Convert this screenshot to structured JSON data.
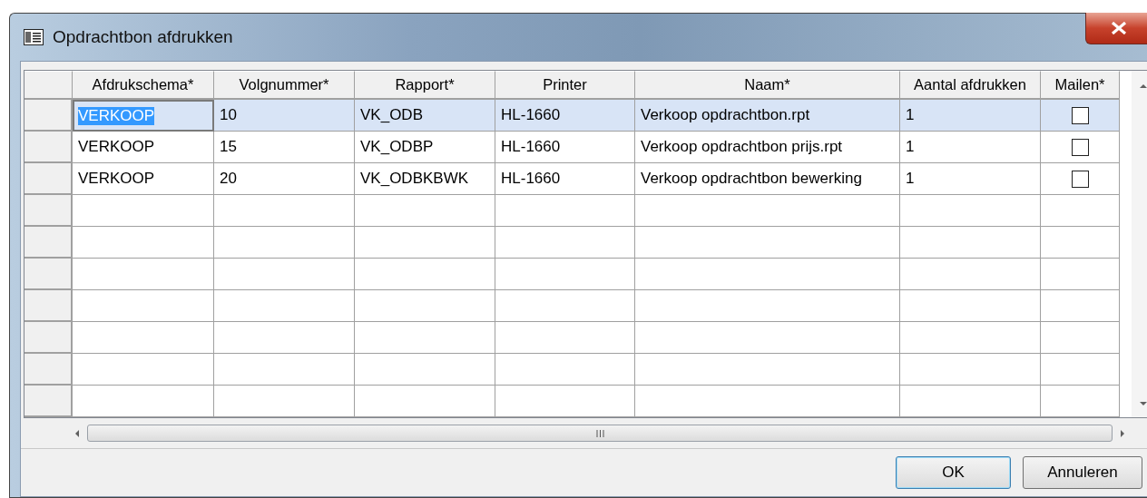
{
  "window": {
    "title": "Opdrachtbon afdrukken"
  },
  "table": {
    "columns": [
      "Afdrukschema*",
      "Volgnummer*",
      "Rapport*",
      "Printer",
      "Naam*",
      "Aantal afdrukken",
      "Mailen*"
    ],
    "rows": [
      {
        "selected": true,
        "cells": [
          "VERKOOP",
          "10",
          "VK_ODB",
          "HL-1660",
          "Verkoop opdrachtbon.rpt",
          "1"
        ],
        "mailen": false
      },
      {
        "selected": false,
        "cells": [
          "VERKOOP",
          "15",
          "VK_ODBP",
          "HL-1660",
          "Verkoop opdrachtbon prijs.rpt",
          "1"
        ],
        "mailen": false
      },
      {
        "selected": false,
        "cells": [
          "VERKOOP",
          "20",
          "VK_ODBKBWK",
          "HL-1660",
          "Verkoop opdrachtbon bewerking",
          "1"
        ],
        "mailen": false
      }
    ]
  },
  "buttons": [
    {
      "label": "OK",
      "default": true
    },
    {
      "label": "Annuleren",
      "default": false
    }
  ]
}
